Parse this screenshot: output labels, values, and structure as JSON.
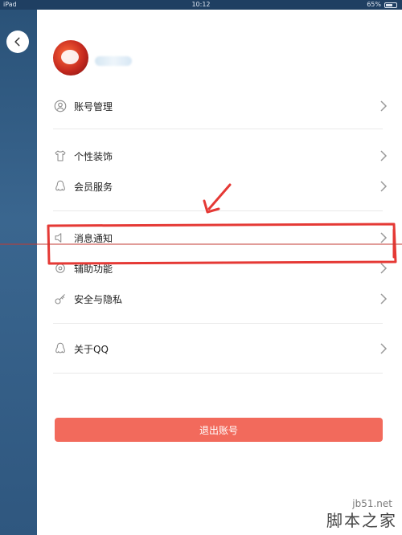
{
  "status": {
    "device": "iPad",
    "time": "10:12",
    "battery": "65%",
    "battery_level": 0.65
  },
  "profile": {
    "username": ""
  },
  "menu": {
    "items": [
      {
        "label": "账号管理",
        "icon": "user-icon"
      },
      {
        "label": "个性装饰",
        "icon": "shirt-icon"
      },
      {
        "label": "会员服务",
        "icon": "penguin-icon"
      },
      {
        "label": "消息通知",
        "icon": "speaker-icon"
      },
      {
        "label": "辅助功能",
        "icon": "assist-icon"
      },
      {
        "label": "安全与隐私",
        "icon": "key-icon"
      },
      {
        "label": "关于QQ",
        "icon": "qq-icon"
      }
    ]
  },
  "logout": {
    "label": "退出账号"
  },
  "watermark": {
    "url": "jb51.net",
    "text": "脚本之家"
  },
  "colors": {
    "accent": "#f26a5c",
    "annotation": "#e53935",
    "left_pane": "#2f577f"
  }
}
